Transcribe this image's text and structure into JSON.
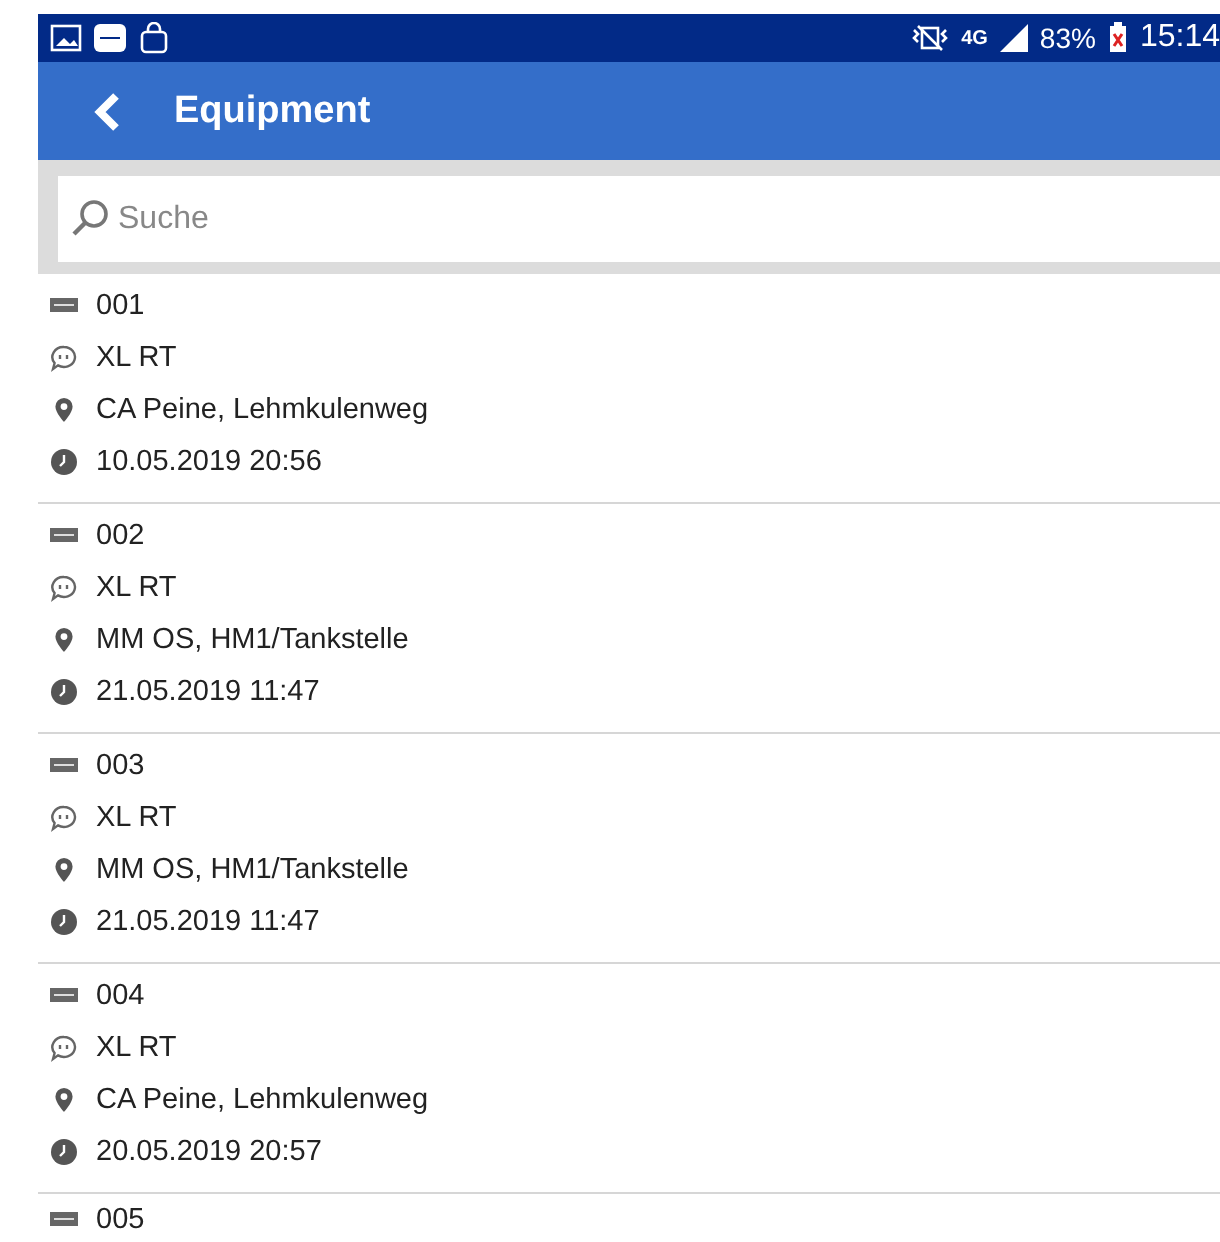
{
  "status_bar": {
    "network": "4G",
    "battery": "83%",
    "time": "15:14"
  },
  "header": {
    "title": "Equipment"
  },
  "search": {
    "placeholder": "Suche"
  },
  "items": [
    {
      "id": "001",
      "model": "XL RT",
      "location": "CA Peine, Lehmkulenweg",
      "timestamp": "10.05.2019 20:56"
    },
    {
      "id": "002",
      "model": "XL RT",
      "location": "MM OS, HM1/Tankstelle",
      "timestamp": "21.05.2019 11:47"
    },
    {
      "id": "003",
      "model": "XL RT",
      "location": "MM OS, HM1/Tankstelle",
      "timestamp": "21.05.2019 11:47"
    },
    {
      "id": "004",
      "model": "XL RT",
      "location": "CA Peine, Lehmkulenweg",
      "timestamp": "20.05.2019 20:57"
    },
    {
      "id": "005"
    }
  ]
}
